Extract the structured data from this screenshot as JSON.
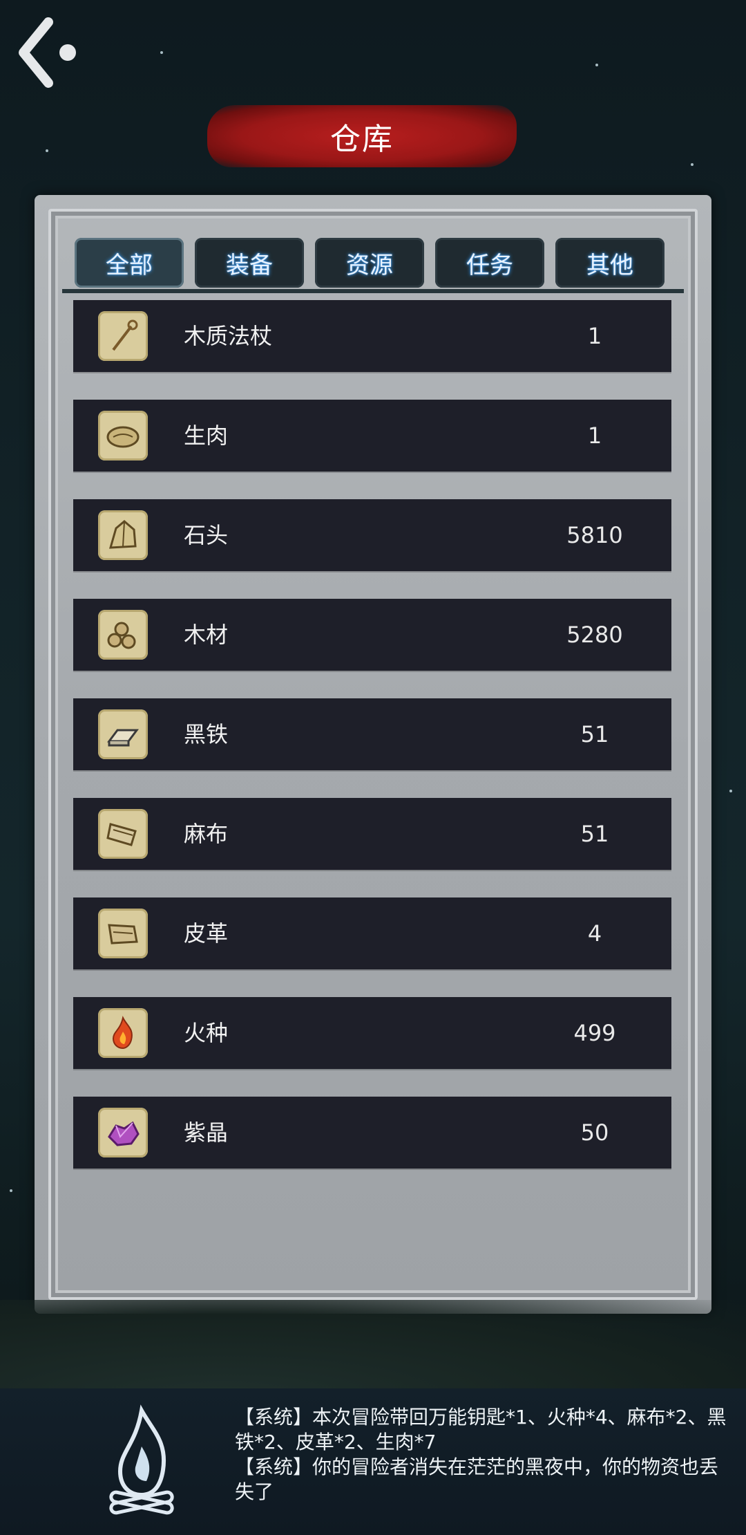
{
  "header": {
    "title": "仓库",
    "back_icon": "back-arrow-icon"
  },
  "tabs": [
    {
      "label": "全部",
      "active": true
    },
    {
      "label": "装备",
      "active": false
    },
    {
      "label": "资源",
      "active": false
    },
    {
      "label": "任务",
      "active": false
    },
    {
      "label": "其他",
      "active": false
    }
  ],
  "items": [
    {
      "name": "木质法杖",
      "count": "1",
      "icon": "staff-icon"
    },
    {
      "name": "生肉",
      "count": "1",
      "icon": "raw-meat-icon"
    },
    {
      "name": "石头",
      "count": "5810",
      "icon": "stone-icon"
    },
    {
      "name": "木材",
      "count": "5280",
      "icon": "wood-logs-icon"
    },
    {
      "name": "黑铁",
      "count": "51",
      "icon": "iron-ingot-icon"
    },
    {
      "name": "麻布",
      "count": "51",
      "icon": "linen-cloth-icon"
    },
    {
      "name": "皮革",
      "count": "4",
      "icon": "leather-icon"
    },
    {
      "name": "火种",
      "count": "499",
      "icon": "fire-seed-icon"
    },
    {
      "name": "紫晶",
      "count": "50",
      "icon": "amethyst-icon"
    }
  ],
  "log": {
    "icon": "campfire-icon",
    "lines": [
      "【系统】本次冒险带回万能钥匙*1、火种*4、麻布*2、黑铁*2、皮革*2、生肉*7",
      "【系统】你的冒险者消失在茫茫的黑夜中，你的物资也丢失了"
    ]
  },
  "colors": {
    "banner": "#9a1717",
    "row_bg": "#1e1f29",
    "icon_bg": "#d9cc9d",
    "panel": "#a7abae"
  }
}
